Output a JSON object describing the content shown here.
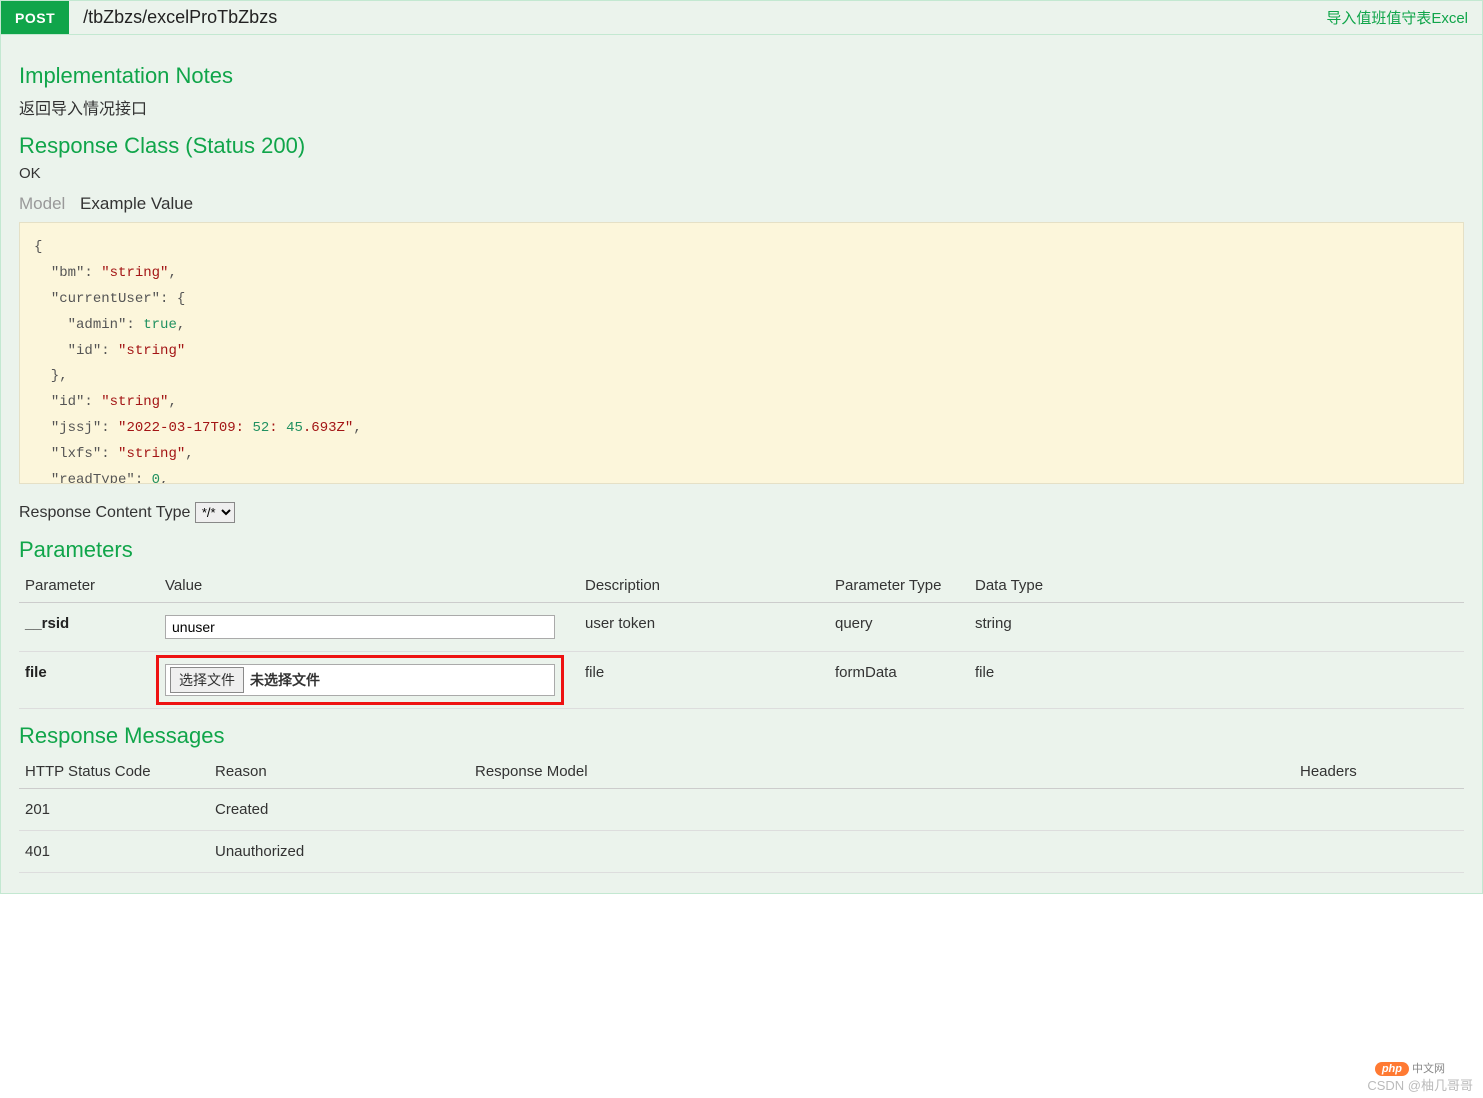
{
  "header": {
    "method": "POST",
    "path": "/tbZbzs/excelProTbZbzs",
    "summary": "导入值班值守表Excel"
  },
  "sections": {
    "impl_notes_title": "Implementation Notes",
    "impl_notes_text": "返回导入情况接口",
    "response_class_title": "Response Class (Status 200)",
    "response_class_status": "OK",
    "parameters_title": "Parameters",
    "response_messages_title": "Response Messages",
    "response_content_type_label": "Response Content Type"
  },
  "tabs": {
    "model": "Model",
    "example": "Example Value"
  },
  "example_json": {
    "lines": [
      "{",
      "  \"bm\": \"string\",",
      "  \"currentUser\": {",
      "    \"admin\": true,",
      "    \"id\": \"string\"",
      "  },",
      "  \"id\": \"string\",",
      "  \"jssj\": \"2022-03-17T09:52:45.693Z\",",
      "  \"lxfs\": \"string\",",
      "  \"readType\": 0,"
    ]
  },
  "content_type_select": {
    "value": "*/*"
  },
  "param_table": {
    "headers": [
      "Parameter",
      "Value",
      "Description",
      "Parameter Type",
      "Data Type"
    ],
    "rows": [
      {
        "name": "__rsid",
        "value": "unuser",
        "description": "user token",
        "param_type": "query",
        "data_type": "string",
        "input_kind": "text"
      },
      {
        "name": "file",
        "file_button": "选择文件",
        "file_status": "未选择文件",
        "description": "file",
        "param_type": "formData",
        "data_type": "file",
        "input_kind": "file",
        "highlight": true
      }
    ]
  },
  "response_table": {
    "headers": [
      "HTTP Status Code",
      "Reason",
      "Response Model",
      "Headers"
    ],
    "rows": [
      {
        "code": "201",
        "reason": "Created"
      },
      {
        "code": "401",
        "reason": "Unauthorized"
      }
    ]
  },
  "watermark": {
    "csdn": "CSDN @柚几哥哥",
    "pill": "php",
    "cn": "中文网"
  }
}
